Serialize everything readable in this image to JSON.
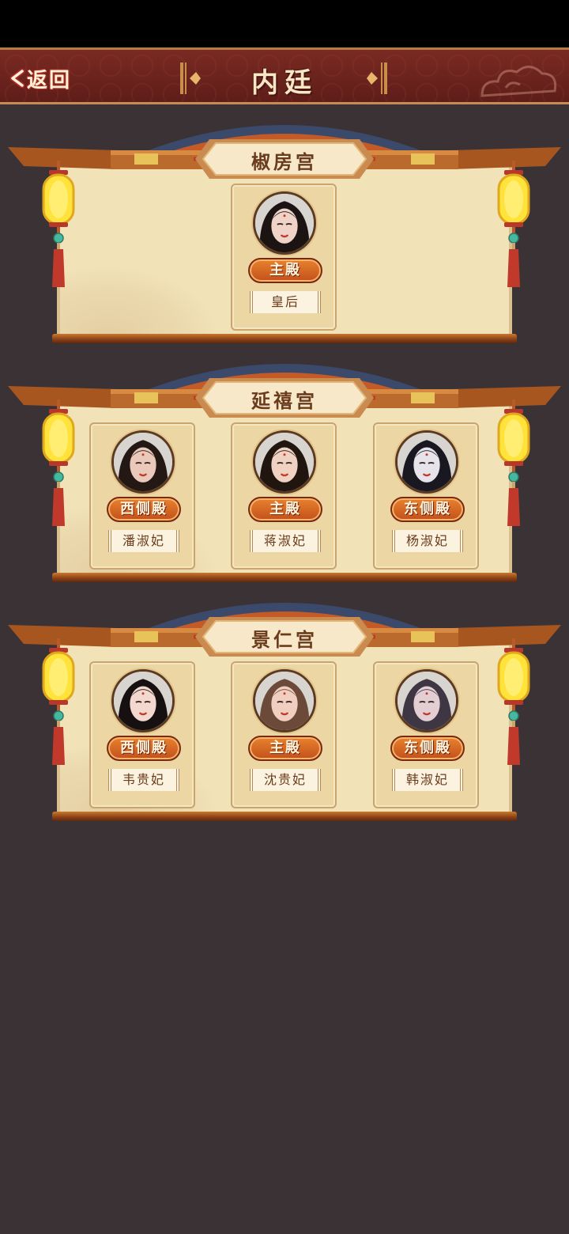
{
  "header": {
    "back_label": "返回",
    "title": "内廷"
  },
  "palaces": [
    {
      "name": "椒房宫",
      "slots": [
        {
          "hall": "主殿",
          "consort": "皇后",
          "portrait_tint": "#efd3c8",
          "hair": "#1b1412"
        }
      ]
    },
    {
      "name": "延禧宫",
      "slots": [
        {
          "hall": "西侧殿",
          "consort": "潘淑妃",
          "portrait_tint": "#eac9bb",
          "hair": "#241815"
        },
        {
          "hall": "主殿",
          "consort": "蒋淑妃",
          "portrait_tint": "#f0d2c2",
          "hair": "#21160f"
        },
        {
          "hall": "东侧殿",
          "consort": "杨淑妃",
          "portrait_tint": "#e6e3ea",
          "hair": "#191821"
        }
      ]
    },
    {
      "name": "景仁宫",
      "slots": [
        {
          "hall": "西侧殿",
          "consort": "韦贵妃",
          "portrait_tint": "#f2d8cf",
          "hair": "#171010"
        },
        {
          "hall": "主殿",
          "consort": "沈贵妃",
          "portrait_tint": "#f1cfc0",
          "hair": "#6b4a3a"
        },
        {
          "hall": "东侧殿",
          "consort": "韩淑妃",
          "portrait_tint": "#e3cfd3",
          "hair": "#3e3643"
        }
      ]
    }
  ],
  "colors": {
    "background": "#3b3236",
    "header": "#6a211c",
    "scroll": "#f2e2b8",
    "badge": "#d8672a"
  }
}
